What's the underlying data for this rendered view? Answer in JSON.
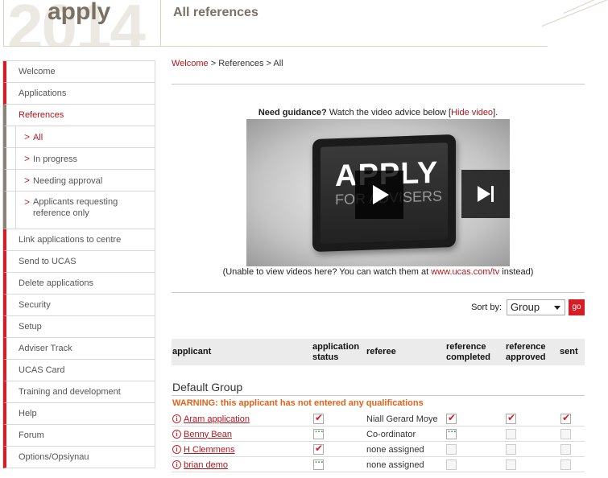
{
  "header": {
    "logo_year": "2014",
    "logo_text": "apply",
    "title": "All references"
  },
  "sidebar": {
    "items": [
      {
        "label": "Welcome"
      },
      {
        "label": "Applications"
      },
      {
        "label": "References"
      },
      {
        "label": "All"
      },
      {
        "label": "In progress"
      },
      {
        "label": "Needing approval"
      },
      {
        "label": "Applicants requesting reference only"
      },
      {
        "label": "Link applications to centre"
      },
      {
        "label": "Send to UCAS"
      },
      {
        "label": "Delete applications"
      },
      {
        "label": "Security"
      },
      {
        "label": "Setup"
      },
      {
        "label": "Adviser Track"
      },
      {
        "label": "UCAS Card"
      },
      {
        "label": "Training and development"
      },
      {
        "label": "Help"
      },
      {
        "label": "Forum"
      },
      {
        "label": "Options/Opsiynau"
      }
    ]
  },
  "breadcrumb": {
    "home": "Welcome",
    "sep1": " > ",
    "mid": "References",
    "sep2": " > ",
    "current": "All"
  },
  "guidance": {
    "bold": "Need guidance?",
    "text": " Watch the video advice below [",
    "hide_link": "Hide video",
    "end": "]."
  },
  "video": {
    "title": "APPLY",
    "subtitle": "FOR ADVISERS"
  },
  "video_note": {
    "before": "(Unable to view videos here? You can watch them at ",
    "link": "www.ucas.com/tv",
    "after": " instead)"
  },
  "sort": {
    "label": "Sort by:",
    "selected": "Group",
    "go_label": "go"
  },
  "table": {
    "headers": {
      "applicant": "applicant",
      "status_1": "application",
      "status_2": "status",
      "referee": "referee",
      "completed_1": "reference",
      "completed_2": "completed",
      "approved_1": "reference",
      "approved_2": "approved",
      "sent": "sent"
    },
    "group_title": "Default Group",
    "warning": "WARNING: this applicant has not entered any qualifications",
    "rows": [
      {
        "applicant": "Aram application",
        "status": "tick",
        "referee": "Niall Gerard Moye",
        "completed": "tick",
        "approved": "tick",
        "sent": "tick"
      },
      {
        "applicant": "Benny Bean",
        "status": "dots",
        "referee": "Co-ordinator",
        "completed": "dots",
        "approved": "empty",
        "sent": "empty"
      },
      {
        "applicant": "H Clemmens",
        "status": "tick",
        "referee": "none assigned",
        "completed": "empty",
        "approved": "empty",
        "sent": "empty"
      },
      {
        "applicant": "brian demo",
        "status": "dots",
        "referee": "none assigned",
        "completed": "empty",
        "approved": "empty",
        "sent": "empty"
      }
    ]
  },
  "colors": {
    "accent": "#d51d25",
    "link": "#b5161c",
    "warning": "#e0631b",
    "header_text": "#7b7064"
  }
}
